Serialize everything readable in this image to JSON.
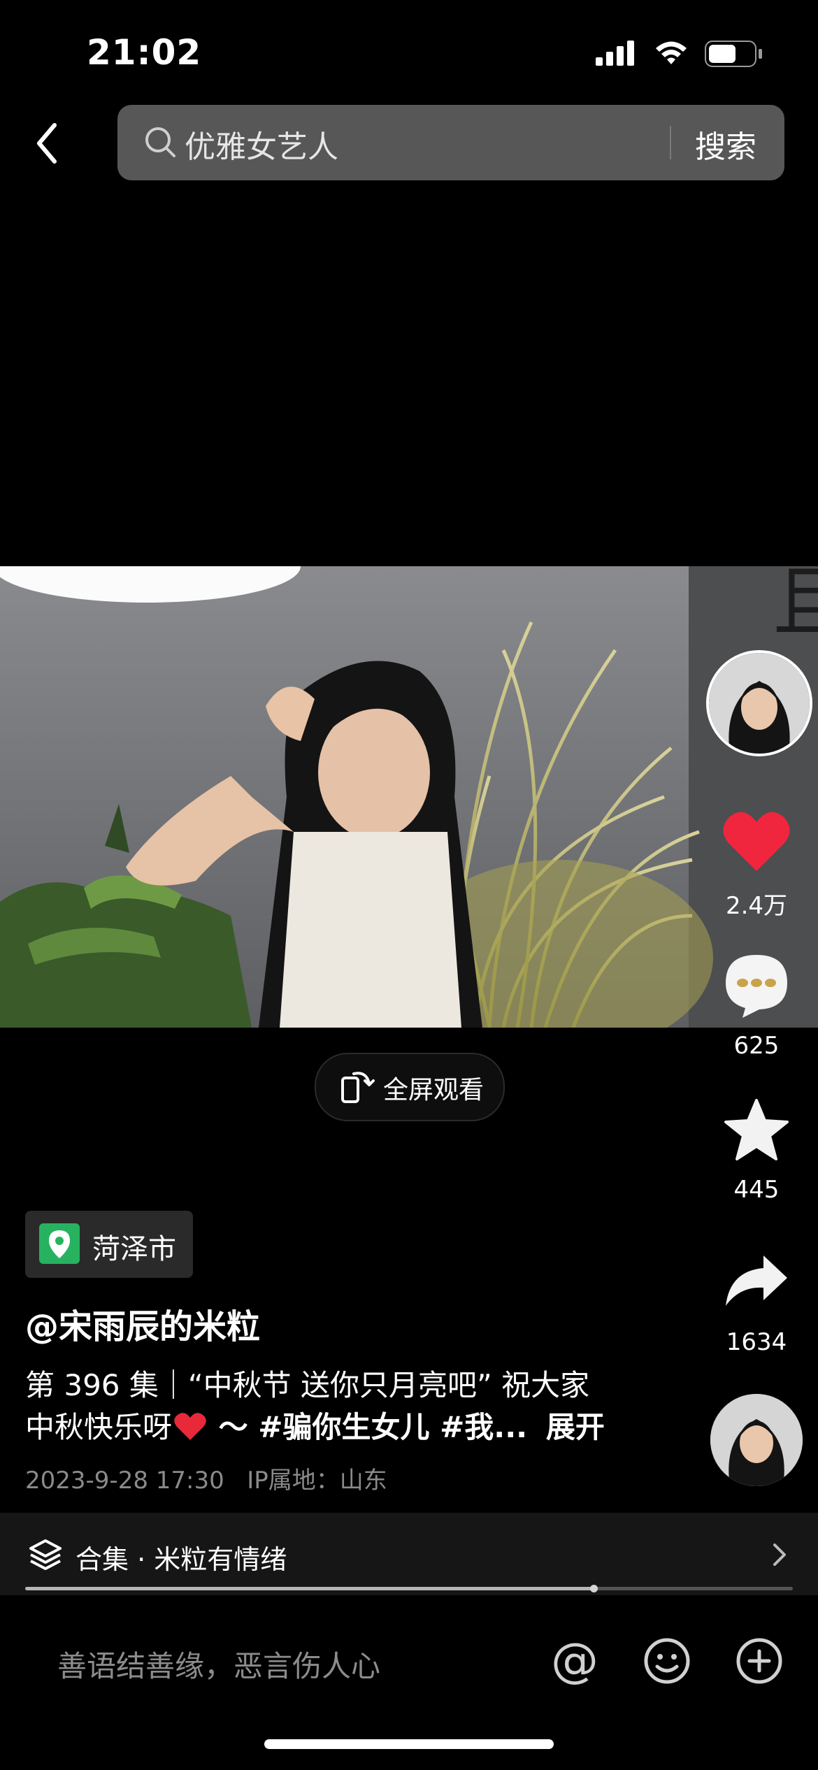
{
  "status_bar": {
    "time": "21:02"
  },
  "search": {
    "query": "优雅女艺人",
    "button_label": "搜索"
  },
  "video": {
    "fullscreen_label": "全屏观看",
    "wall_text": "且 街"
  },
  "actions": {
    "likes": "2.4万",
    "comments": "625",
    "favorites": "445",
    "shares": "1634"
  },
  "post": {
    "location": "菏泽市",
    "author": "@宋雨辰的米粒",
    "description_line1": "第 396 集｜“中秋节 送你只月亮吧” 祝大家",
    "description_line2_text": "中秋快乐呀",
    "description_line2_rest": " ～ #骗你生女儿 #我...",
    "expand_label": "展开",
    "date": "2023-9-28 17:30",
    "ip_location": "IP属地：山东"
  },
  "collection": {
    "label": "合集 · 米粒有情绪",
    "progress": 0.74
  },
  "comment_bar": {
    "placeholder": "善语结善缘，恶言伤人心"
  },
  "colors": {
    "like_red": "#f0263f",
    "location_green": "#27b25f"
  }
}
